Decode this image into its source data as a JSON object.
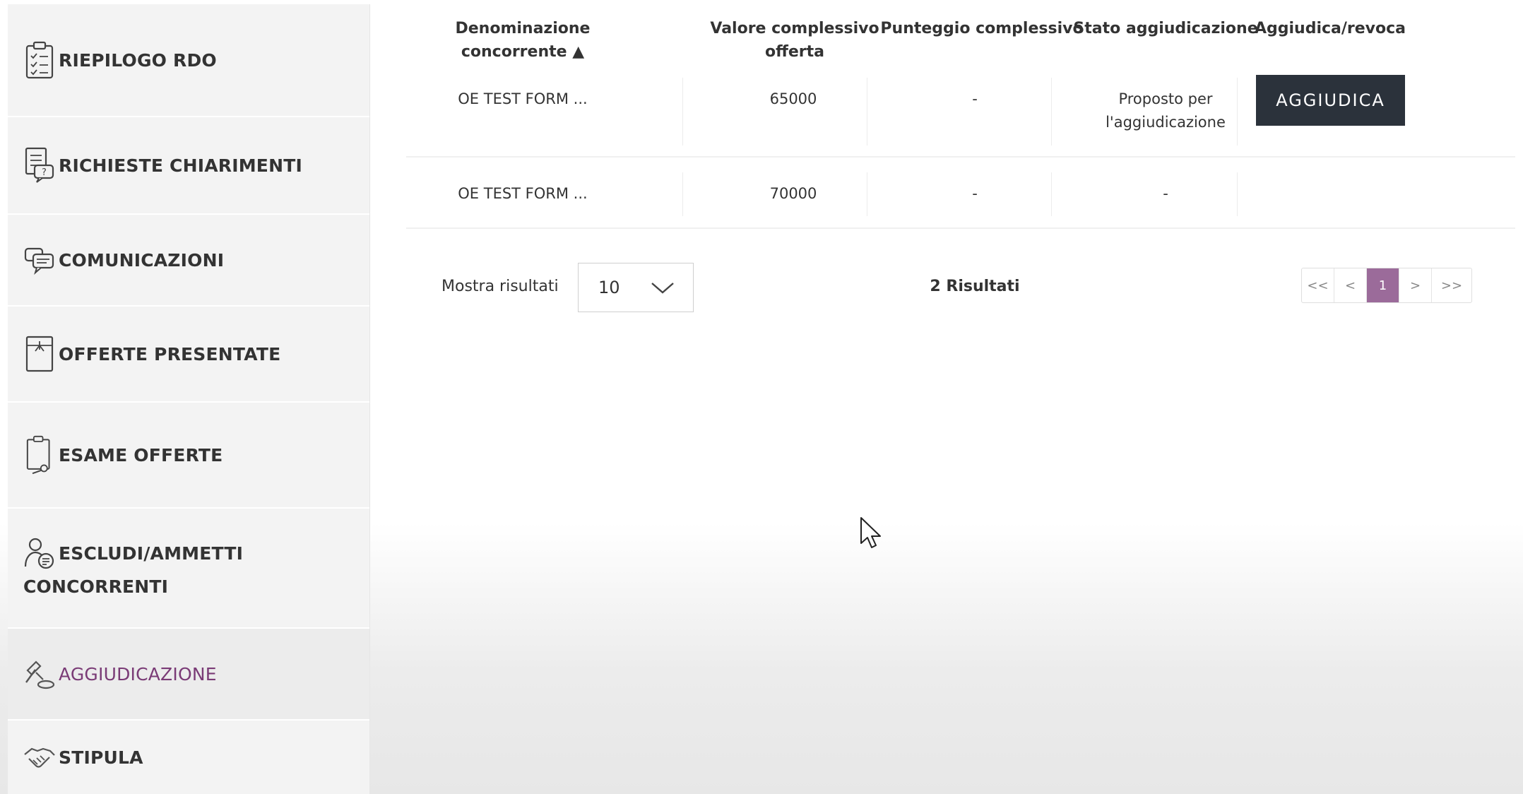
{
  "sidebar": {
    "items": [
      {
        "label": "RIEPILOGO RDO",
        "icon": "clipboard-checklist-icon"
      },
      {
        "label": "RICHIESTE CHIARIMENTI",
        "icon": "document-question-icon"
      },
      {
        "label": "COMUNICAZIONI",
        "icon": "chat-bubbles-icon"
      },
      {
        "label": "OFFERTE PRESENTATE",
        "icon": "offer-document-icon"
      },
      {
        "label": "ESAME OFFERTE",
        "icon": "document-magnifier-icon"
      },
      {
        "label_line1": "ESCLUDI/AMMETTI",
        "label_line2": "CONCORRENTI",
        "icon": "person-list-icon"
      },
      {
        "label": "AGGIUDICAZIONE",
        "icon": "gavel-icon",
        "active": true
      },
      {
        "label": "STIPULA",
        "icon": "handshake-icon"
      }
    ]
  },
  "table": {
    "headers": {
      "name": "Denominazione concorrente ▲",
      "value_line1": "Valore complessivo",
      "value_line2": "offerta",
      "score": "Punteggio complessivo",
      "status": "Stato aggiudicazione",
      "action": "Aggiudica/revoca"
    },
    "rows": [
      {
        "name": "OE TEST FORM ...",
        "value": "65000",
        "score": "-",
        "status_line1": "Proposto per",
        "status_line2": "l'aggiudicazione",
        "action_label": "AGGIUDICA"
      },
      {
        "name": "OE TEST FORM ...",
        "value": "70000",
        "score": "-",
        "status": "-"
      }
    ]
  },
  "pagination": {
    "show_results_label": "Mostra risultati",
    "page_size": "10",
    "results_count": "2 Risultati",
    "first": "<<",
    "prev": "<",
    "current_page": "1",
    "next": ">",
    "last": ">>"
  },
  "colors": {
    "accent": "#7a3b76",
    "pager_active": "#9b6b9a",
    "button_dark": "#2b323b",
    "sidebar_bg": "#f3f3f3"
  }
}
